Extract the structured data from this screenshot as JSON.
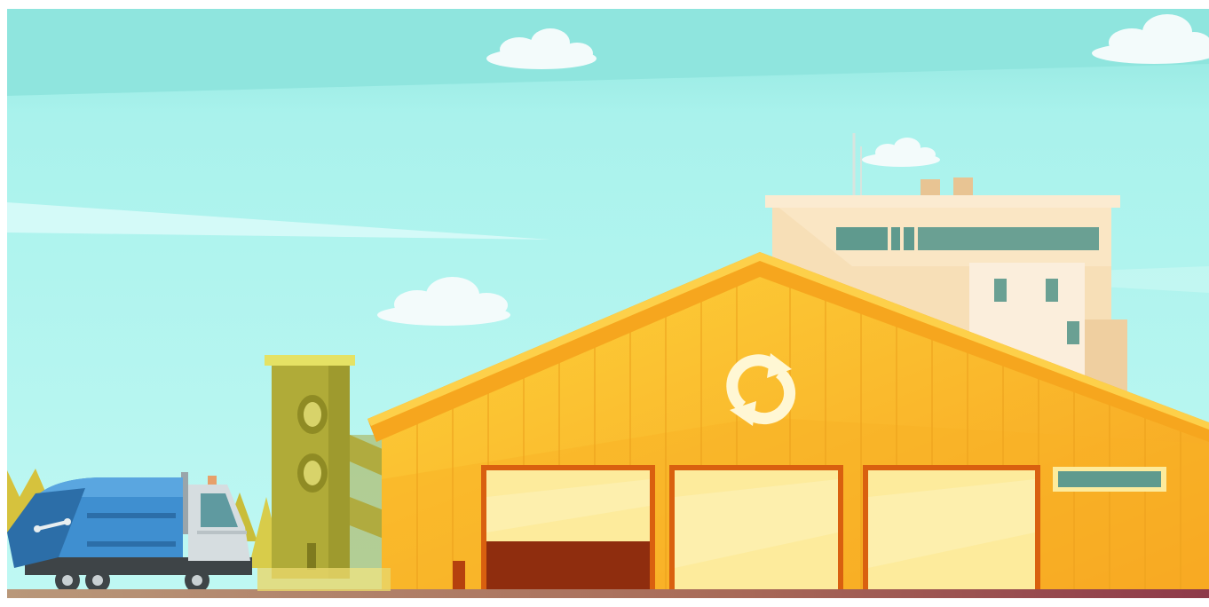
{
  "scene": {
    "description_tag": "",
    "colors": {
      "sky_top": "#8ee6e0",
      "sky_bottom": "#b8f6f2",
      "cloud": "#f2fbfb",
      "ground": "#a8795e",
      "warehouse_wall": "#fcc12e",
      "warehouse_roof": "#f29a16",
      "warehouse_dark": "#e27c10",
      "door_glass": "#fdeb9c",
      "door_frame": "#d9600f",
      "door_open": "#8f2d0e",
      "building": "#f8e2bb",
      "building_dark": "#eccb97",
      "window_teal": "#5f9a8e",
      "tower": "#b2ad3a",
      "tower_dark": "#969227",
      "truck_body": "#3f8fd0",
      "truck_body_dark": "#2c6ea8",
      "truck_cab": "#d6dde0",
      "wheel": "#3e4447"
    },
    "icons": [
      "recycle-icon"
    ]
  }
}
